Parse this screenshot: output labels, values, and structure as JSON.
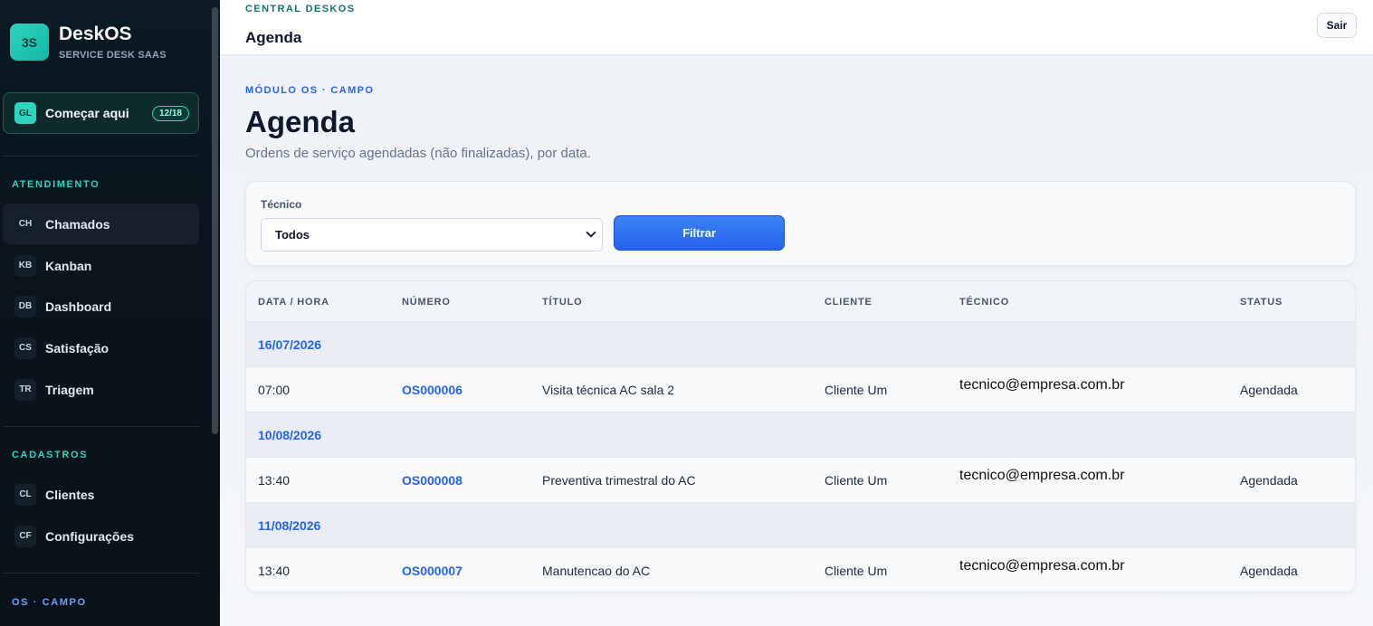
{
  "brand": {
    "logo": "3S",
    "title": "DeskOS",
    "subtitle": "SERVICE DESK SAAS"
  },
  "start": {
    "badge": "GL",
    "label": "Começar aqui",
    "count": "12/18"
  },
  "sidebar": {
    "sections": [
      {
        "label": "ATENDIMENTO",
        "items": [
          {
            "abbr": "CH",
            "label": "Chamados",
            "active": true
          },
          {
            "abbr": "KB",
            "label": "Kanban"
          },
          {
            "abbr": "DB",
            "label": "Dashboard"
          },
          {
            "abbr": "CS",
            "label": "Satisfação"
          },
          {
            "abbr": "TR",
            "label": "Triagem"
          }
        ]
      },
      {
        "label": "CADASTROS",
        "items": [
          {
            "abbr": "CL",
            "label": "Clientes"
          },
          {
            "abbr": "CF",
            "label": "Configurações"
          }
        ]
      },
      {
        "label": "OS · CAMPO",
        "items": []
      }
    ]
  },
  "topbar": {
    "kicker": "CENTRAL DESKOS",
    "title": "Agenda",
    "logout_label": "Sair"
  },
  "page": {
    "kicker": "MÓDULO OS · CAMPO",
    "title": "Agenda",
    "subtitle": "Ordens de serviço agendadas (não finalizadas), por data."
  },
  "filter": {
    "label": "Técnico",
    "selected": "Todos",
    "button": "Filtrar"
  },
  "table": {
    "headers": [
      "DATA / HORA",
      "NÚMERO",
      "TÍTULO",
      "CLIENTE",
      "TÉCNICO",
      "STATUS"
    ],
    "groups": [
      {
        "date": "16/07/2026",
        "rows": [
          {
            "time": "07:00",
            "number": "OS000006",
            "title": "Visita técnica AC sala 2",
            "client": "Cliente Um",
            "tech": "tecnico@empresa.com.br",
            "status": "Agendada"
          }
        ]
      },
      {
        "date": "10/08/2026",
        "rows": [
          {
            "time": "13:40",
            "number": "OS000008",
            "title": "Preventiva trimestral do AC",
            "client": "Cliente Um",
            "tech": "tecnico@empresa.com.br",
            "status": "Agendada"
          }
        ]
      },
      {
        "date": "11/08/2026",
        "rows": [
          {
            "time": "13:40",
            "number": "OS000007",
            "title": "Manutencao do AC",
            "client": "Cliente Um",
            "tech": "tecnico@empresa.com.br",
            "status": "Agendada"
          }
        ]
      }
    ]
  },
  "colors": {
    "accent": "#2dd4bf",
    "link": "#2563eb",
    "sidebar_bg": "#0a141c"
  }
}
